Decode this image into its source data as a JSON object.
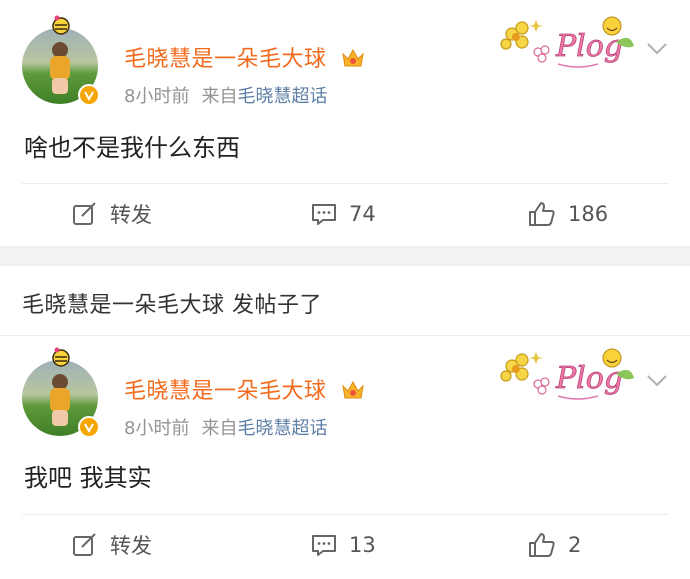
{
  "posts": [
    {
      "author": "毛晓慧是一朵毛大球",
      "time": "8小时前",
      "source_prefix": "来自",
      "source": "毛晓慧超话",
      "sticker_text": "Plog",
      "content": "啥也不是我什么东西",
      "actions": {
        "repost": "转发",
        "comments": "74",
        "likes": "186"
      }
    },
    {
      "author": "毛晓慧是一朵毛大球",
      "time": "8小时前",
      "source_prefix": "来自",
      "source": "毛晓慧超话",
      "sticker_text": "Plog",
      "content": "我吧 我其实",
      "actions": {
        "repost": "转发",
        "comments": "13",
        "likes": "2"
      }
    }
  ],
  "notice": "毛晓慧是一朵毛大球 发帖子了",
  "colors": {
    "name": "#f26b1d",
    "meta": "#939393",
    "source_link": "#5d7fa6",
    "separator": "#f2f2f2"
  }
}
